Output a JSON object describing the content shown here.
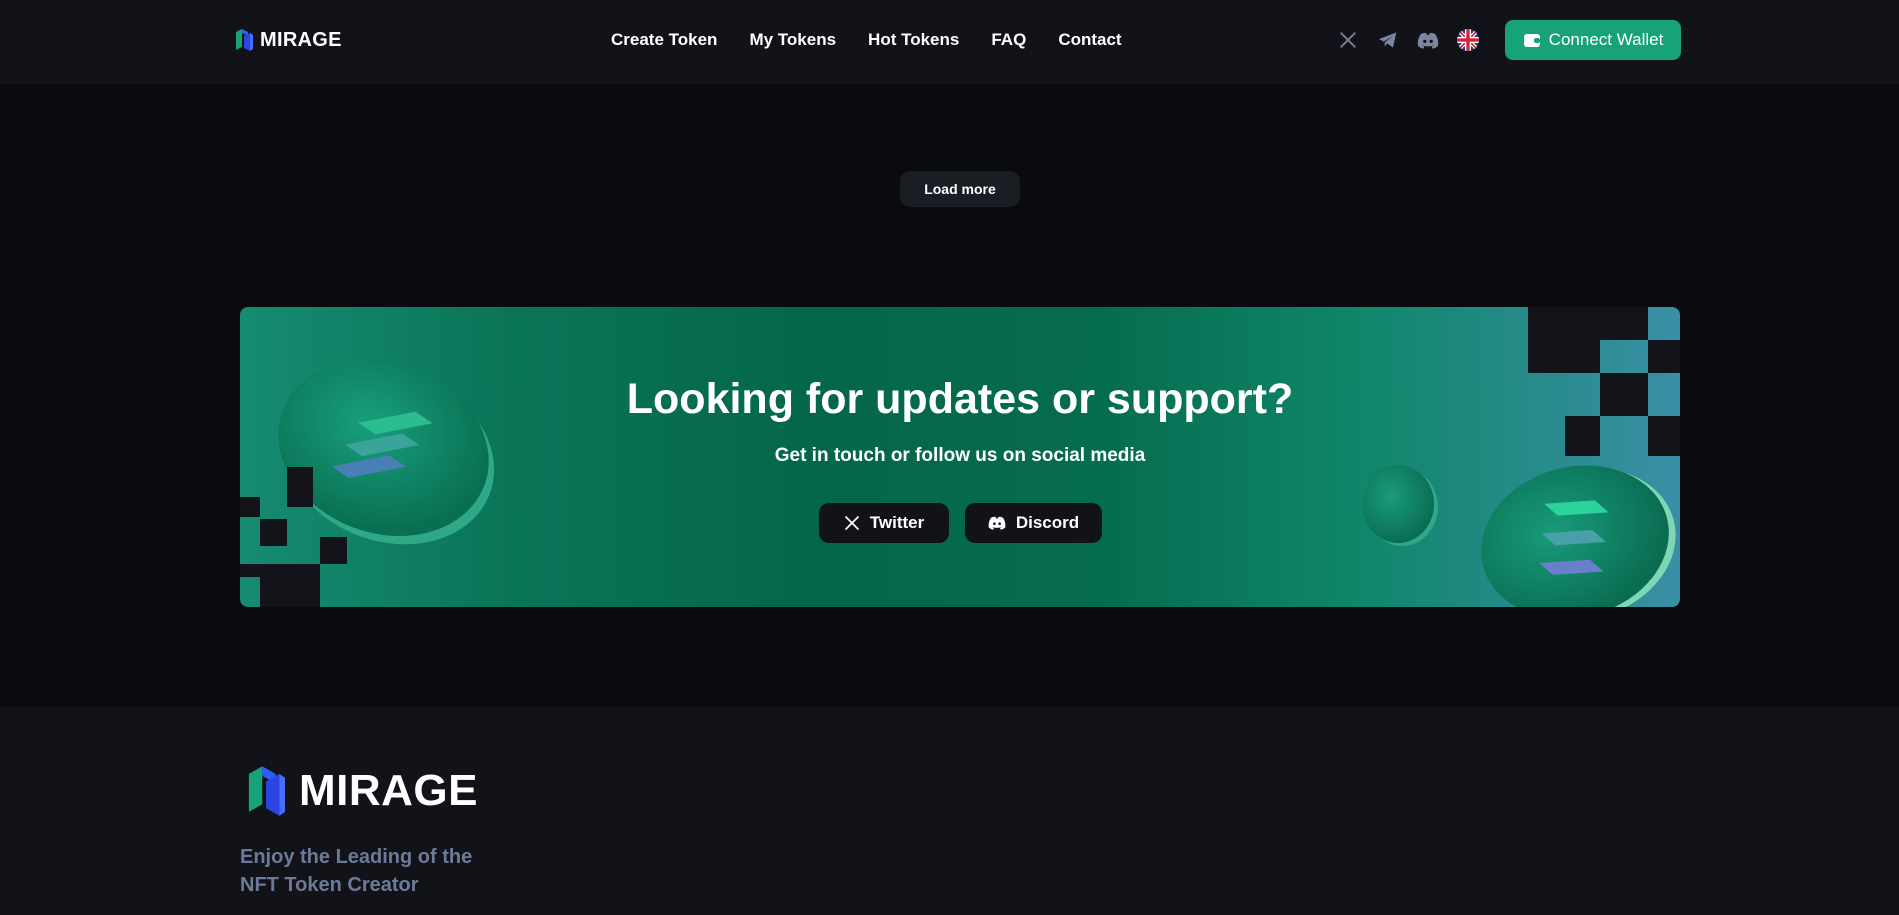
{
  "header": {
    "brand": "MIRAGE",
    "nav": [
      "Create Token",
      "My Tokens",
      "Hot Tokens",
      "FAQ",
      "Contact"
    ],
    "socials": [
      "x-icon",
      "telegram-icon",
      "discord-icon"
    ],
    "language": "uk-flag-icon",
    "connect_label": "Connect Wallet"
  },
  "main": {
    "load_more_label": "Load more"
  },
  "banner": {
    "title": "Looking for updates or support?",
    "subtitle": "Get in touch or follow us on social media",
    "twitter_label": "Twitter",
    "discord_label": "Discord"
  },
  "footer": {
    "brand": "MIRAGE",
    "tagline": "Enjoy the Leading of the NFT Token Creator"
  },
  "colors": {
    "accent": "#16a37a",
    "header_bg": "#111318",
    "page_bg": "#0a0b0e",
    "muted_text": "#6c7a99"
  }
}
